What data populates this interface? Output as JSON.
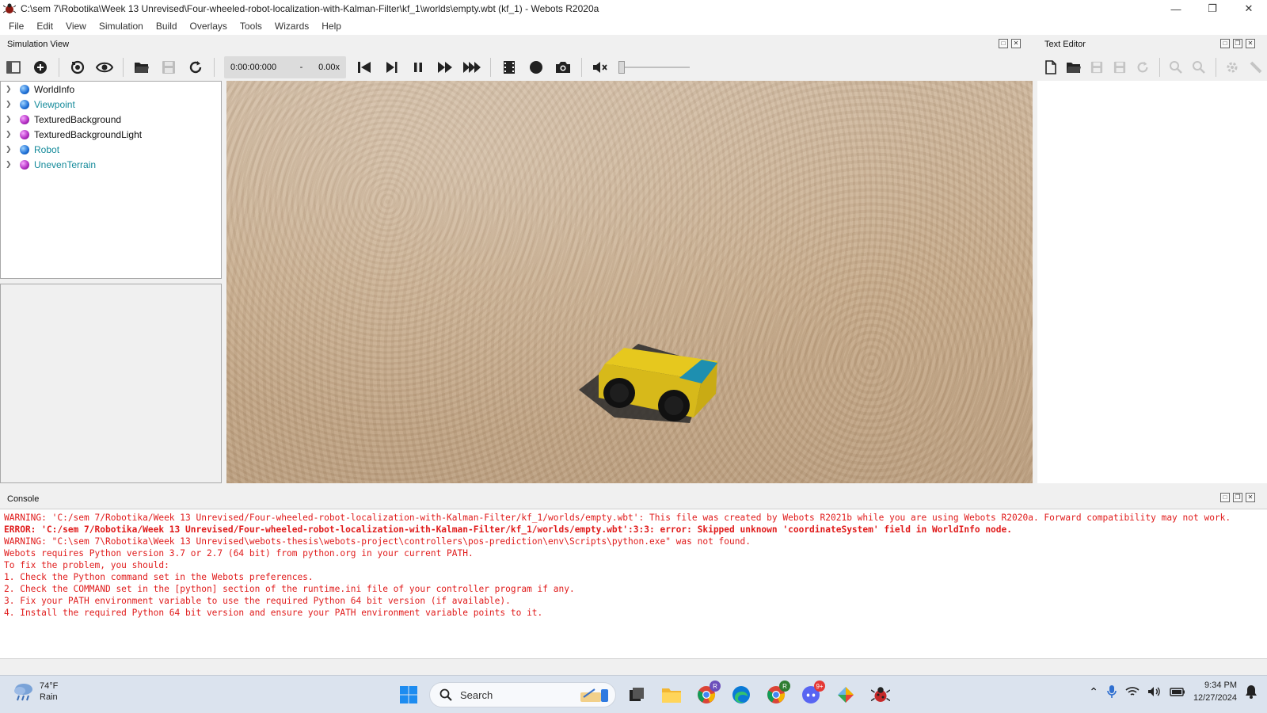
{
  "window": {
    "title": "C:\\sem 7\\Robotika\\Week 13 Unrevised\\Four-wheeled-robot-localization-with-Kalman-Filter\\kf_1\\worlds\\empty.wbt (kf_1) - Webots R2020a"
  },
  "menu": [
    "File",
    "Edit",
    "View",
    "Simulation",
    "Build",
    "Overlays",
    "Tools",
    "Wizards",
    "Help"
  ],
  "docks": {
    "simulation_view": "Simulation View",
    "text_editor": "Text Editor",
    "console": "Console"
  },
  "toolbar": {
    "time": "0:00:00:000",
    "dash": "-",
    "speed": "0.00x"
  },
  "scene_tree": [
    {
      "label": "WorldInfo",
      "ball": "blue",
      "color": "black"
    },
    {
      "label": "Viewpoint",
      "ball": "blue",
      "color": "teal"
    },
    {
      "label": "TexturedBackground",
      "ball": "purple",
      "color": "black"
    },
    {
      "label": "TexturedBackgroundLight",
      "ball": "purple",
      "color": "black"
    },
    {
      "label": "Robot",
      "ball": "blue",
      "color": "teal"
    },
    {
      "label": "UnevenTerrain",
      "ball": "purple",
      "color": "teal"
    }
  ],
  "console_lines": [
    {
      "text": "WARNING: 'C:/sem 7/Robotika/Week 13 Unrevised/Four-wheeled-robot-localization-with-Kalman-Filter/kf_1/worlds/empty.wbt': This file was created by Webots R2021b while you are using Webots R2020a. Forward compatibility may not work.",
      "kind": "warn"
    },
    {
      "text": "ERROR: 'C:/sem 7/Robotika/Week 13 Unrevised/Four-wheeled-robot-localization-with-Kalman-Filter/kf_1/worlds/empty.wbt':3:3: error: Skipped unknown 'coordinateSystem' field in WorldInfo node.",
      "kind": "err"
    },
    {
      "text": "WARNING: \"C:\\sem 7\\Robotika\\Week 13 Unrevised\\webots-thesis\\webots-project\\controllers\\pos-prediction\\env\\Scripts\\python.exe\" was not found.",
      "kind": "warn"
    },
    {
      "text": "Webots requires Python version 3.7 or 2.7 (64 bit) from python.org in your current PATH.",
      "kind": "warn"
    },
    {
      "text": "To fix the problem, you should:",
      "kind": "warn"
    },
    {
      "text": "1. Check the Python command set in the Webots preferences.",
      "kind": "warn"
    },
    {
      "text": "2. Check the COMMAND set in the [python] section of the runtime.ini file of your controller program if any.",
      "kind": "warn"
    },
    {
      "text": "3. Fix your PATH environment variable to use the required Python 64 bit version (if available).",
      "kind": "warn"
    },
    {
      "text": "4. Install the required Python 64 bit version and ensure your PATH environment variable points to it.",
      "kind": "warn"
    }
  ],
  "taskbar": {
    "weather_temp": "74°F",
    "weather_desc": "Rain",
    "search_label": "Search",
    "time": "9:34 PM",
    "date": "12/27/2024",
    "badges": {
      "chrome1": "R",
      "chrome2": "R",
      "discord": "9+"
    }
  },
  "colors": {
    "console_text": "#e01b1b",
    "robot_body": "#e6c81e",
    "robot_panel": "#1e8fb0",
    "ground": "#c4a888"
  }
}
